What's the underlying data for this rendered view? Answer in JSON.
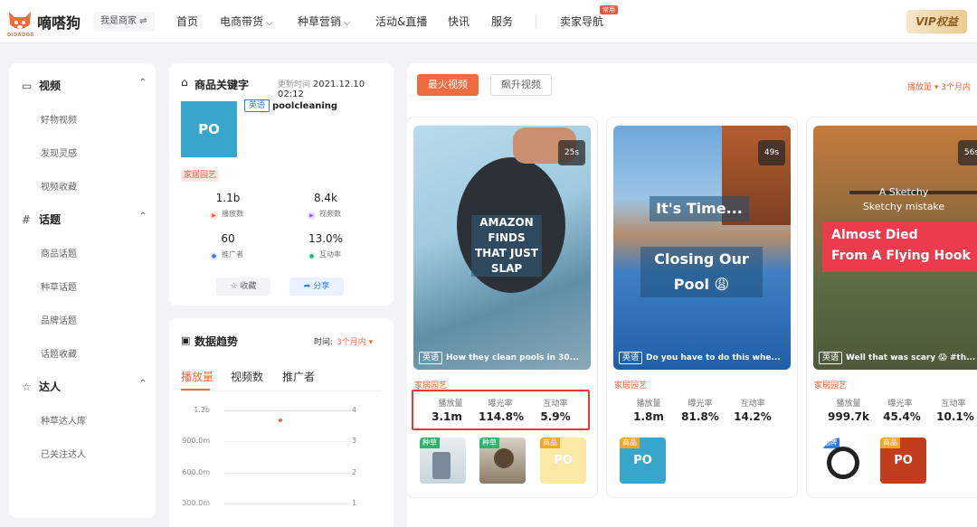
{
  "header": {
    "logo_text": "嘀嗒狗",
    "logo_sub": "DIDADOG",
    "merchant": "我是商家 ⇌",
    "nav": [
      {
        "label": "首页",
        "chevron": false
      },
      {
        "label": "电商带货",
        "chevron": true
      },
      {
        "label": "种草营销",
        "chevron": true
      },
      {
        "label": "活动&直播",
        "chevron": false
      },
      {
        "label": "快讯",
        "chevron": false
      },
      {
        "label": "服务",
        "chevron": false
      }
    ],
    "seller_nav": "卖家导航",
    "seller_badge": "常用",
    "vip": "VIP权益"
  },
  "sidebar": {
    "sections": [
      {
        "icon": "video-icon",
        "glyph": "▭",
        "label": "视频",
        "items": [
          "好物视频",
          "发现灵感",
          "视频收藏"
        ]
      },
      {
        "icon": "topic-icon",
        "glyph": "#",
        "label": "话题",
        "items": [
          "商品话题",
          "种草话题",
          "品牌话题",
          "话题收藏"
        ]
      },
      {
        "icon": "star-icon",
        "glyph": "☆",
        "label": "达人",
        "items": [
          "种草达人库",
          "已关注达人"
        ]
      }
    ]
  },
  "keyword_card": {
    "title": "商品关键字",
    "update_label": "更新时间",
    "update_time": "2021.12.10 02:12",
    "thumb": "PO",
    "lang": "英语",
    "keyword": "poolcleaning",
    "category": "家居园艺",
    "stats": [
      {
        "value": "1.1b",
        "label": "播放数",
        "color": "#ef5a3c"
      },
      {
        "value": "8.4k",
        "label": "视频数",
        "color": "#8a5cf6"
      },
      {
        "value": "60",
        "label": "推广者",
        "color": "#2f7de1"
      },
      {
        "value": "13.0%",
        "label": "互动率",
        "color": "#22b07a"
      }
    ],
    "fav": "收藏",
    "share": "分享"
  },
  "trend": {
    "title": "数据趋势",
    "time_label": "时间:",
    "time_value": "3个月内 ▾",
    "tabs": [
      "播放量",
      "视频数",
      "推广者"
    ],
    "y_left": [
      "1.2b",
      "900.0m",
      "600.0m",
      "300.0m"
    ],
    "y_right": [
      "4",
      "3",
      "2",
      "1"
    ]
  },
  "videos_panel": {
    "hot": "最火视频",
    "rise": "飙升视频",
    "sort": "播放量 ▾  3个月内",
    "metric_labels": [
      "播放量",
      "曝光率",
      "互动率"
    ],
    "videos": [
      {
        "duration": "25s",
        "overlay": [
          "AMAZON",
          "FINDS",
          "THAT JUST",
          "SLAP"
        ],
        "lang": "英语",
        "caption": "How they clean pools in 30...",
        "category": "家居园艺",
        "metrics": [
          "3.1m",
          "114.8%",
          "5.9%"
        ],
        "thumbs": [
          {
            "tag": "种草",
            "text": ""
          },
          {
            "tag": "种草",
            "text": ""
          },
          {
            "tag": "商品",
            "text": "PO"
          }
        ]
      },
      {
        "duration": "49s",
        "overlay": [
          "It's Time...",
          "Closing Our",
          "Pool 😩"
        ],
        "lang": "英语",
        "caption": "Do you have to do this whe...",
        "category": "家居园艺",
        "metrics": [
          "1.8m",
          "81.8%",
          "14.2%"
        ],
        "thumbs": [
          {
            "tag": "商品",
            "text": "PO"
          }
        ]
      },
      {
        "duration": "56s",
        "overlay": [
          "A Sketchy",
          "Sketchy mistake",
          "Almost Died",
          "From A Flying Hook"
        ],
        "lang": "英语",
        "caption": "Well that was scary 😱 #th...",
        "category": "家居园艺",
        "metrics": [
          "999.7k",
          "45.4%",
          "10.1%"
        ],
        "thumbs": [
          {
            "tag": "品牌",
            "text": ""
          },
          {
            "tag": "商品",
            "text": "PO"
          }
        ]
      }
    ]
  }
}
